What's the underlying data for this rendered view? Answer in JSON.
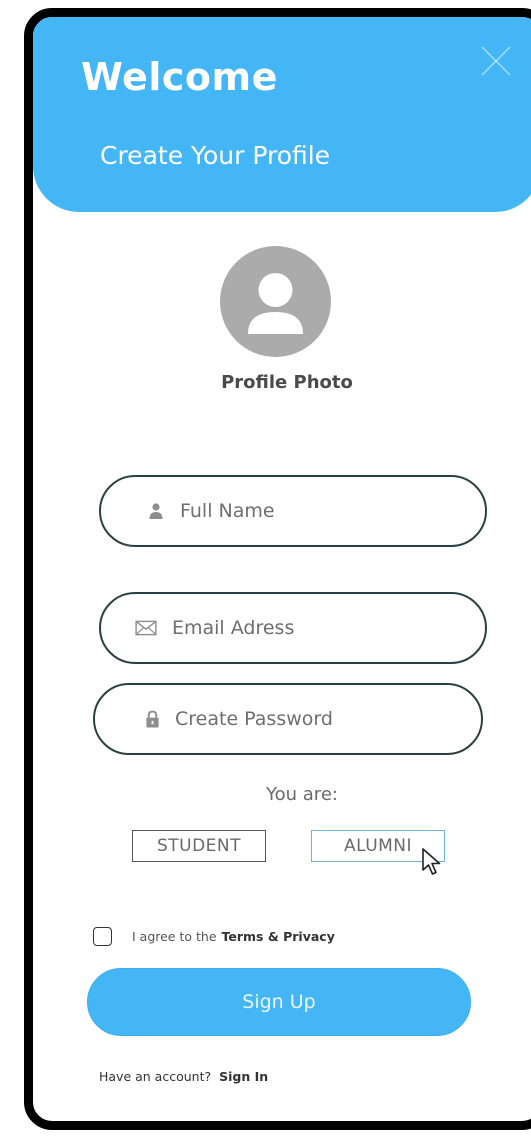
{
  "header": {
    "title": "Welcome",
    "subtitle": "Create Your Profile",
    "close_icon": "close-icon"
  },
  "profile": {
    "avatar_icon": "user-avatar-icon",
    "label": "Profile Photo"
  },
  "form": {
    "full_name": {
      "placeholder": "Full Name",
      "value": "",
      "icon": "user-icon"
    },
    "email": {
      "placeholder": "Email Adress",
      "value": "",
      "icon": "envelope-icon"
    },
    "password": {
      "placeholder": "Create Password",
      "value": "",
      "icon": "lock-icon"
    }
  },
  "role": {
    "prompt": "You are:",
    "options": [
      "STUDENT",
      "ALUMNI"
    ],
    "hovered": "ALUMNI"
  },
  "agreement": {
    "checked": false,
    "text": "I agree to the",
    "link": "Terms & Privacy"
  },
  "actions": {
    "signup_label": "Sign Up",
    "have_account_text": "Have an account?",
    "signin_label": "Sign In"
  },
  "colors": {
    "accent": "#45b6f5",
    "field_border": "#2b4042",
    "avatar_gray": "#ababab"
  }
}
